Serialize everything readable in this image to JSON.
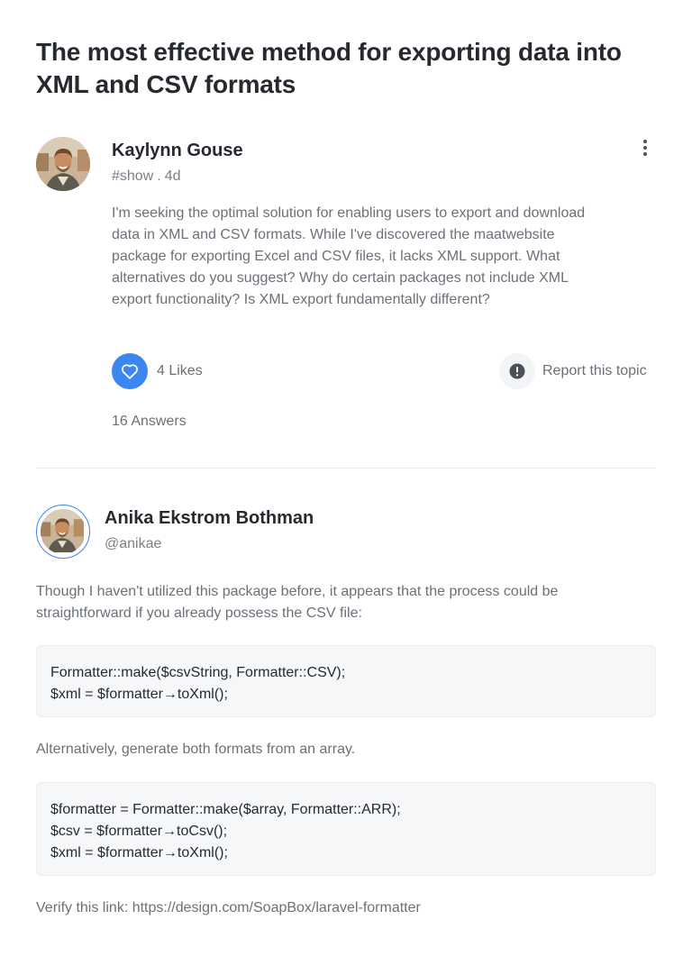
{
  "topic": {
    "title": "The most effective method for exporting data into XML and CSV formats"
  },
  "question": {
    "author": "Kaylynn Gouse",
    "tag": "#show",
    "separator": ".",
    "age": "4d",
    "body": "I'm seeking the optimal solution for enabling users to export and download data in XML and CSV formats. While I've discovered the maatwebsite package for exporting Excel and CSV files, it lacks XML support. What alternatives do you suggest? Why do certain packages not include XML export functionality? Is XML export fundamentally different?",
    "likes_label": "4 Likes",
    "report_label": "Report this topic",
    "answers_label": "16 Answers"
  },
  "answer": {
    "author": "Anika Ekstrom Bothman",
    "handle": "@anikae",
    "intro": "Though I haven't utilized this package before, it appears that the process could be straightforward if you already possess the CSV file:",
    "code1": [
      "Formatter::make($csvString, Formatter::CSV);",
      "$xml = $formatter→toXml();"
    ],
    "middle": "Alternatively, generate both formats from an array.",
    "code2": [
      "$formatter = Formatter::make($array, Formatter::ARR);",
      "$csv = $formatter→toCsv();",
      "$xml = $formatter→toXml();"
    ],
    "outro": "Verify this link: https://design.com/SoapBox/laravel-formatter"
  },
  "icons": {
    "like": "heart-icon",
    "report": "exclamation-circle-icon",
    "menu": "more-vertical-icon"
  },
  "colors": {
    "accent": "#3b86f0",
    "text_primary": "#262a30",
    "text_secondary": "#6b7079",
    "code_bg": "#f6f7f8"
  }
}
